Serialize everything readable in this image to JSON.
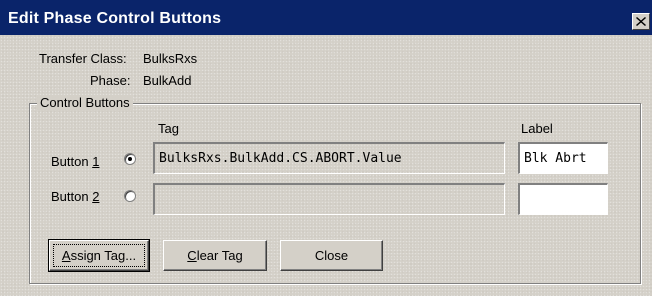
{
  "window": {
    "title": "Edit Phase Control Buttons",
    "close_glyph": "close-icon"
  },
  "info": {
    "transfer_class_label": "Transfer Class:",
    "transfer_class_value": "BulksRxs",
    "phase_label": "Phase:",
    "phase_value": "BulkAdd"
  },
  "control_buttons": {
    "legend": "Control Buttons",
    "columns": {
      "tag": "Tag",
      "label": "Label"
    },
    "rows": [
      {
        "label_prefix": "Button ",
        "label_mnemonic": "1",
        "selected": true,
        "tag": "BulksRxs.BulkAdd.CS.ABORT.Value",
        "label": "Blk Abrt"
      },
      {
        "label_prefix": "Button ",
        "label_mnemonic": "2",
        "selected": false,
        "tag": "",
        "label": ""
      }
    ]
  },
  "actions": {
    "assign": {
      "mnemonic": "A",
      "rest": "ssign Tag..."
    },
    "clear": {
      "mnemonic": "C",
      "rest": "lear Tag"
    },
    "close": "Close"
  }
}
